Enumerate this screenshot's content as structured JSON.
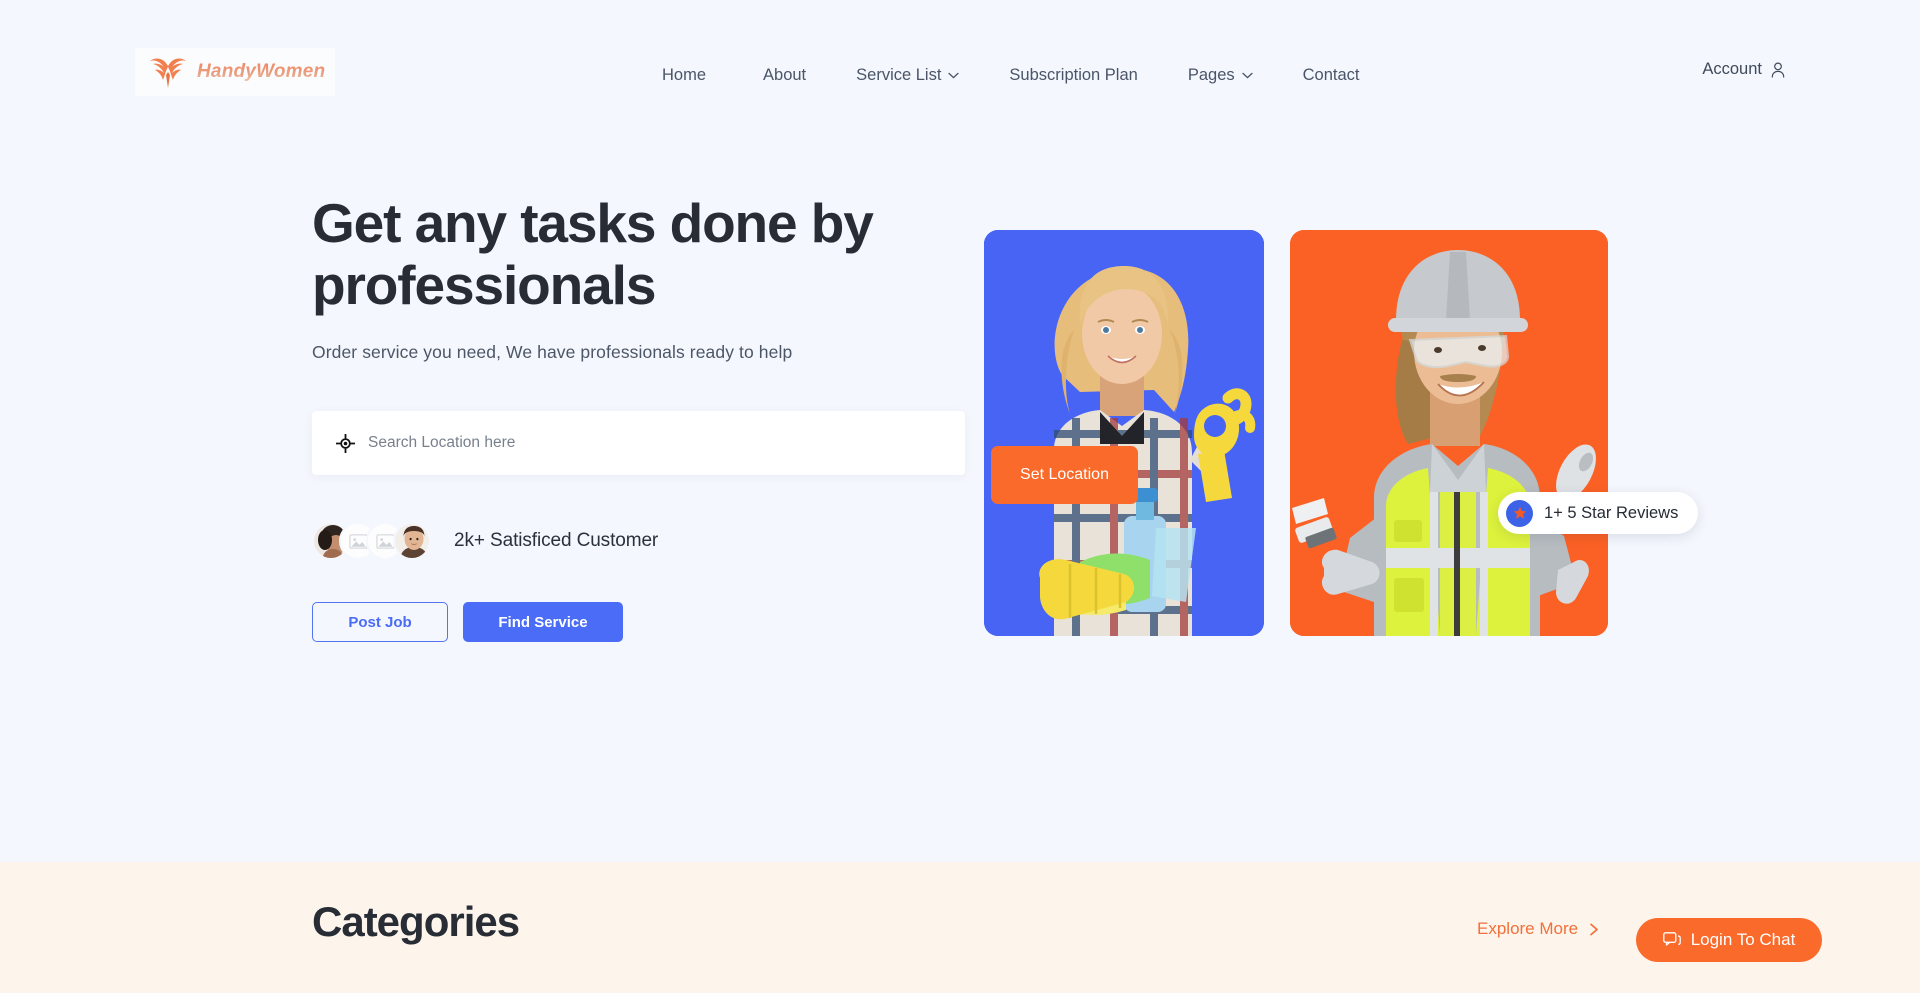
{
  "header": {
    "logo": {
      "text": "HandyWomen",
      "icon": "eagle-logo-icon"
    },
    "nav": [
      {
        "label": "Home",
        "has_dropdown": false
      },
      {
        "label": "About",
        "has_dropdown": false
      },
      {
        "label": "Service List",
        "has_dropdown": true
      },
      {
        "label": "Subscription Plan",
        "has_dropdown": false
      },
      {
        "label": "Pages",
        "has_dropdown": true
      },
      {
        "label": "Contact",
        "has_dropdown": false
      }
    ],
    "account": {
      "label": "Account",
      "icon": "user-icon"
    }
  },
  "hero": {
    "title": "Get any tasks done by professionals",
    "title_line1": "Get any tasks done by",
    "title_line2": "professionals",
    "subtitle": "Order service you need, We have professionals ready to help",
    "search": {
      "placeholder": "Search Location here",
      "value": "",
      "icon": "gps-target-icon"
    },
    "social_proof": {
      "text": "2k+ Satisficed Customer",
      "avatar_count": 4
    },
    "buttons": {
      "post_job": "Post Job",
      "find_service": "Find Service"
    },
    "cards": {
      "blue_card": {
        "alt": "cleaning-professional-photo",
        "bg": "#4764f5"
      },
      "orange_card": {
        "alt": "painter-professional-photo",
        "bg": "#fb6124"
      }
    },
    "set_location_badge": "Set Location",
    "review_badge": {
      "text": "1+ 5 Star Reviews",
      "icon": "star-icon"
    }
  },
  "categories": {
    "title": "Categories",
    "explore_more": "Explore More",
    "chat_button": "Login To Chat"
  },
  "colors": {
    "primary_blue": "#4a6cf7",
    "accent_orange": "#f96a2b",
    "hero_bg": "#f4f7fd",
    "categories_bg": "#fdf5ec",
    "text_dark": "#272c35"
  }
}
